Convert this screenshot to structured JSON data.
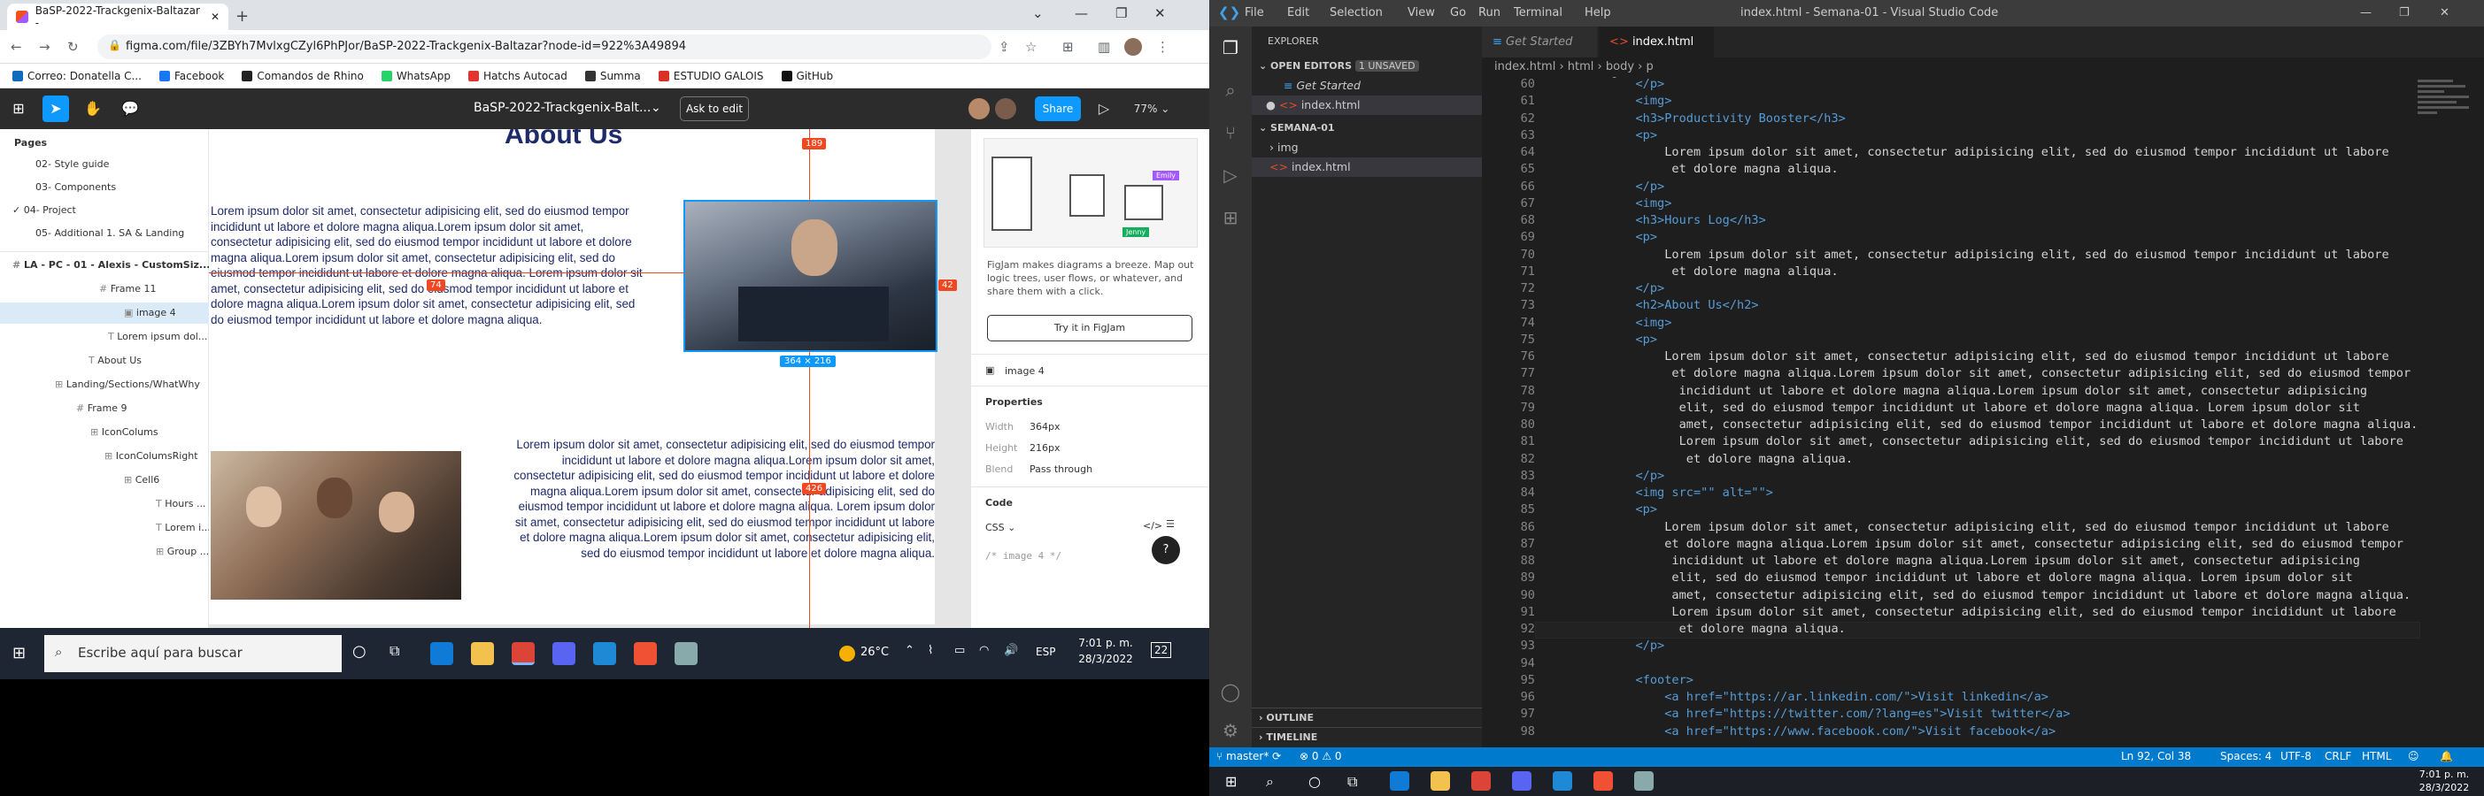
{
  "browser": {
    "tab_title": "BaSP-2022-Trackgenix-Baltazar -",
    "url": "figma.com/file/3ZBYh7MvlxgCZyl6PhPJor/BaSP-2022-Trackgenix-Baltazar?node-id=922%3A49894",
    "bookmarks": [
      {
        "label": "Correo: Donatella C...",
        "color": "#0f6cbd"
      },
      {
        "label": "Facebook",
        "color": "#1877f2"
      },
      {
        "label": "Comandos de Rhino",
        "color": "#222222"
      },
      {
        "label": "WhatsApp",
        "color": "#25d366"
      },
      {
        "label": "Hatchs Autocad",
        "color": "#e3342f"
      },
      {
        "label": "Summa",
        "color": "#333333"
      },
      {
        "label": "ESTUDIO GALOIS",
        "color": "#d93025"
      },
      {
        "label": "GitHub",
        "color": "#111111"
      }
    ]
  },
  "figma": {
    "file_title": "BaSP-2022-Trackgenix-Balt...",
    "ask_label": "Ask to edit",
    "share_label": "Share",
    "zoom": "77%",
    "pages_label": "Pages",
    "pages": [
      "02- Style guide",
      "03- Components",
      "04- Project",
      "05- Additional 1. SA & Landing"
    ],
    "layers": [
      "LA - PC - 01 - Alexis - CustomSiz...",
      "Frame 11",
      "image 4",
      "Lorem ipsum dol...",
      "About Us",
      "Landing/Sections/WhatWhy",
      "Frame 9",
      "IconColums",
      "IconColumsRight",
      "Cell6",
      "Hours ...",
      "Lorem i...",
      "Group ..."
    ],
    "canvas": {
      "heading": "About Us",
      "para1": "Lorem ipsum dolor sit amet, consectetur adipisicing elit, sed do eiusmod tempor incididunt ut labore et dolore magna aliqua.Lorem ipsum dolor sit amet, consectetur adipisicing elit, sed do eiusmod tempor incididunt ut labore et dolore magna aliqua.Lorem ipsum dolor sit amet, consectetur adipisicing elit, sed do eiusmod tempor incididunt ut labore et dolore magna aliqua. Lorem ipsum dolor sit amet, consectetur adipisicing elit, sed do eiusmod tempor incididunt ut labore et dolore magna aliqua.Lorem ipsum dolor sit amet, consectetur adipisicing elit, sed do eiusmod tempor incididunt ut labore et dolore magna aliqua.",
      "para2": "Lorem ipsum dolor sit amet, consectetur adipisicing elit, sed do eiusmod tempor incididunt ut labore et dolore magna aliqua.Lorem ipsum dolor sit amet, consectetur adipisicing elit, sed do eiusmod tempor incididunt ut labore et dolore magna aliqua.Lorem ipsum dolor sit amet, consectetur adipisicing elit, sed do eiusmod tempor incididunt ut labore et dolore magna aliqua. Lorem ipsum dolor sit amet, consectetur adipisicing elit, sed do eiusmod tempor incididunt ut labore et dolore magna aliqua.Lorem ipsum dolor sit amet, consectetur adipisicing elit, sed do eiusmod tempor incididunt ut labore et dolore magna aliqua.",
      "m189": "189",
      "m42": "42",
      "m74": "74",
      "m426": "426",
      "dims": "364 × 216"
    },
    "right": {
      "figjam_text": "FigJam makes diagrams a breeze. Map out logic trees, user flows, or whatever, and share them with a click.",
      "figjam_btn": "Try it in FigJam",
      "selection": "image 4",
      "props_title": "Properties",
      "width_label": "Width",
      "width_val": "364px",
      "height_label": "Height",
      "height_val": "216px",
      "blend_label": "Blend",
      "blend_val": "Pass through",
      "code_title": "Code",
      "css_label": "CSS",
      "comment": "/* image 4 */",
      "emily": "Emily",
      "jenny": "Jenny",
      "help": "?"
    }
  },
  "win_left": {
    "search_placeholder": "Escribe aquí para buscar",
    "weather": "26°C",
    "lang": "ESP",
    "time": "7:01 p. m.",
    "date": "28/3/2022",
    "notif": "22"
  },
  "vscode": {
    "window_title": "index.html - Semana-01 - Visual Studio Code",
    "menu": [
      "File",
      "Edit",
      "Selection",
      "View",
      "Go",
      "Run",
      "Terminal",
      "Help"
    ],
    "explorer_label": "EXPLORER",
    "open_editors": "OPEN EDITORS",
    "unsaved": "1 UNSAVED",
    "open_files": [
      "Get Started",
      "index.html"
    ],
    "folder": "SEMANA-01",
    "tree": [
      "img",
      "index.html"
    ],
    "outline": "OUTLINE",
    "timeline": "TIMELINE",
    "tabs": [
      "Get Started",
      "index.html"
    ],
    "crumbs": [
      "index.html",
      "html",
      "body",
      "p"
    ],
    "lines": [
      {
        "n": "60",
        "t": "        </p>"
      },
      {
        "n": "61",
        "t": "        <img>"
      },
      {
        "n": "62",
        "t": "        <h3>Productivity Booster</h3>"
      },
      {
        "n": "63",
        "t": "        <p>"
      },
      {
        "n": "64",
        "t": "            Lorem ipsum dolor sit amet, consectetur adipisicing elit, sed do eiusmod tempor incididunt ut labore"
      },
      {
        "n": "65",
        "t": "             et dolore magna aliqua."
      },
      {
        "n": "66",
        "t": "        </p>"
      },
      {
        "n": "67",
        "t": "        <img>"
      },
      {
        "n": "68",
        "t": "        <h3>Hours Log</h3>"
      },
      {
        "n": "69",
        "t": "        <p>"
      },
      {
        "n": "70",
        "t": "            Lorem ipsum dolor sit amet, consectetur adipisicing elit, sed do eiusmod tempor incididunt ut labore"
      },
      {
        "n": "71",
        "t": "             et dolore magna aliqua."
      },
      {
        "n": "72",
        "t": "        </p>"
      },
      {
        "n": "73",
        "t": "        <h2>About Us</h2>"
      },
      {
        "n": "74",
        "t": "        <img>"
      },
      {
        "n": "75",
        "t": "        <p>"
      },
      {
        "n": "76",
        "t": "            Lorem ipsum dolor sit amet, consectetur adipisicing elit, sed do eiusmod tempor incididunt ut labore"
      },
      {
        "n": "77",
        "t": "             et dolore magna aliqua.Lorem ipsum dolor sit amet, consectetur adipisicing elit, sed do eiusmod tempor"
      },
      {
        "n": "78",
        "t": "              incididunt ut labore et dolore magna aliqua.Lorem ipsum dolor sit amet, consectetur adipisicing"
      },
      {
        "n": "79",
        "t": "              elit, sed do eiusmod tempor incididunt ut labore et dolore magna aliqua. Lorem ipsum dolor sit"
      },
      {
        "n": "80",
        "t": "              amet, consectetur adipisicing elit, sed do eiusmod tempor incididunt ut labore et dolore magna aliqua."
      },
      {
        "n": "81",
        "t": "              Lorem ipsum dolor sit amet, consectetur adipisicing elit, sed do eiusmod tempor incididunt ut labore"
      },
      {
        "n": "82",
        "t": "               et dolore magna aliqua."
      },
      {
        "n": "83",
        "t": "        </p>"
      },
      {
        "n": "84",
        "t": "        <img src=\"\" alt=\"\">"
      },
      {
        "n": "85",
        "t": "        <p>"
      },
      {
        "n": "86",
        "t": "            Lorem ipsum dolor sit amet, consectetur adipisicing elit, sed do eiusmod tempor incididunt ut labore"
      },
      {
        "n": "87",
        "t": "            et dolore magna aliqua.Lorem ipsum dolor sit amet, consectetur adipisicing elit, sed do eiusmod tempor"
      },
      {
        "n": "88",
        "t": "             incididunt ut labore et dolore magna aliqua.Lorem ipsum dolor sit amet, consectetur adipisicing"
      },
      {
        "n": "89",
        "t": "             elit, sed do eiusmod tempor incididunt ut labore et dolore magna aliqua. Lorem ipsum dolor sit"
      },
      {
        "n": "90",
        "t": "             amet, consectetur adipisicing elit, sed do eiusmod tempor incididunt ut labore et dolore magna aliqua."
      },
      {
        "n": "91",
        "t": "             Lorem ipsum dolor sit amet, consectetur adipisicing elit, sed do eiusmod tempor incididunt ut labore"
      },
      {
        "n": "92",
        "t": "              et dolore magna aliqua."
      },
      {
        "n": "93",
        "t": "        </p>"
      },
      {
        "n": "94",
        "t": ""
      },
      {
        "n": "95",
        "t": "        <footer>"
      },
      {
        "n": "96",
        "t": "            <a href=\"https://ar.linkedin.com/\">Visit linkedin</a>"
      },
      {
        "n": "97",
        "t": "            <a href=\"https://twitter.com/?lang=es\">Visit twitter</a>"
      },
      {
        "n": "98",
        "t": "            <a href=\"https://www.facebook.com/\">Visit facebook</a>"
      }
    ],
    "status": {
      "branch": "master*",
      "errors": "0",
      "warnings": "0",
      "position": "Ln 92, Col 38",
      "spaces": "Spaces: 4",
      "encoding": "UTF-8",
      "eol": "CRLF",
      "lang": "HTML"
    },
    "time": "7:01 p. m.",
    "date": "28/3/2022"
  }
}
